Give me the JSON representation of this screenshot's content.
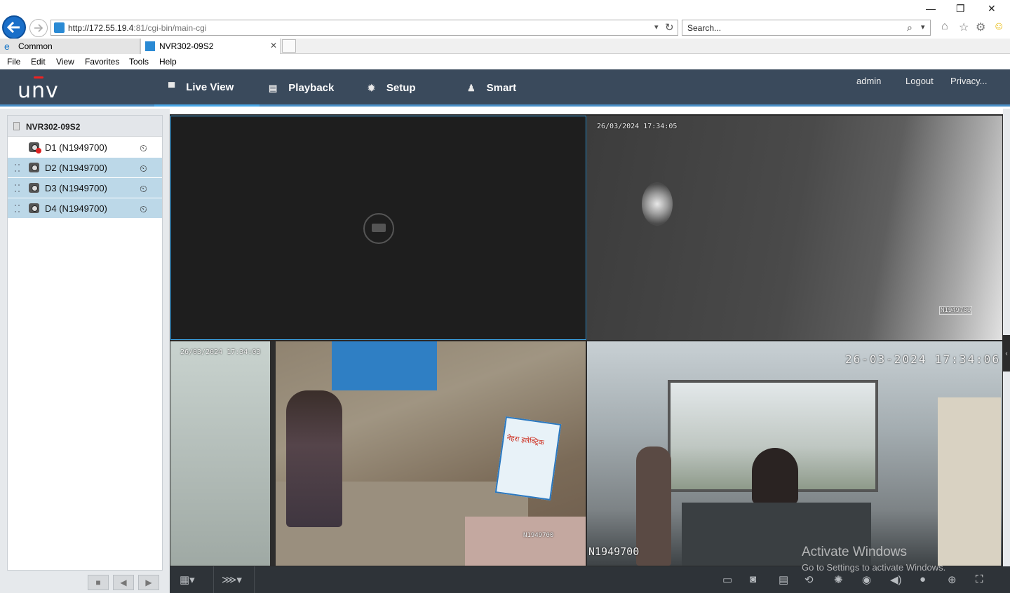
{
  "browser": {
    "url_host": "http://172.55.19.4",
    "url_rest": ":81/cgi-bin/main-cgi",
    "search_placeholder": "Search...",
    "tabs": [
      {
        "label": "Common"
      },
      {
        "label": "NVR302-09S2"
      }
    ],
    "menu": [
      "File",
      "Edit",
      "View",
      "Favorites",
      "Tools",
      "Help"
    ]
  },
  "app": {
    "logo": "unv",
    "nav": [
      {
        "label": "Live View",
        "icon": "monitor-icon",
        "active": true
      },
      {
        "label": "Playback",
        "icon": "film-icon",
        "active": false
      },
      {
        "label": "Setup",
        "icon": "gear-icon",
        "active": false
      },
      {
        "label": "Smart",
        "icon": "person-icon",
        "active": false
      }
    ],
    "header_links": [
      "admin",
      "Logout",
      "Privacy..."
    ]
  },
  "device_tree": {
    "root": "NVR302-09S2",
    "channels": [
      {
        "label": "D1 (N1949700)",
        "status": "offline"
      },
      {
        "label": "D2 (N1949700)",
        "status": "live"
      },
      {
        "label": "D3 (N1949700)",
        "status": "live"
      },
      {
        "label": "D4 (N1949700)",
        "status": "live"
      }
    ]
  },
  "video": {
    "tile2": {
      "timestamp": "26/03/2024 17:34:05",
      "cam_id": "N1949700"
    },
    "tile3": {
      "timestamp": "26/03/2024 17:34:03",
      "cam_id": "N1949700",
      "sign_text": "नेहरा इलेक्ट्रिक"
    },
    "tile4": {
      "timestamp": "26-03-2024 17:34:06",
      "cam_id": "N1949700"
    }
  },
  "watermark": {
    "line1": "Activate Windows",
    "line2": "Go to Settings to activate Windows."
  }
}
